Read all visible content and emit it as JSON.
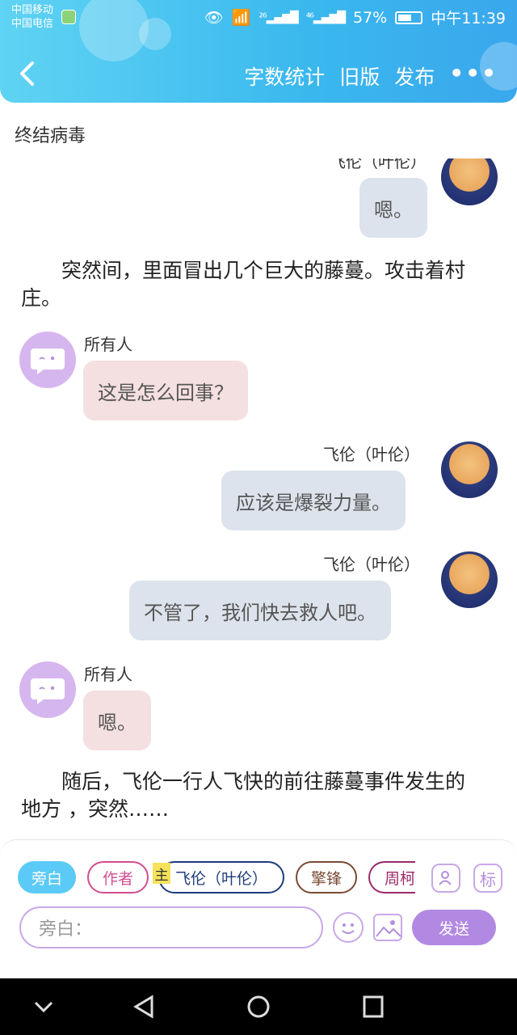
{
  "status_bar": {
    "carrier1": "中国移动",
    "carrier2": "中国电信",
    "sig1": "²⁶",
    "sig2": "⁴⁶",
    "battery": "57%",
    "time": "中午11:39"
  },
  "header": {
    "actions": [
      "字数统计",
      "旧版",
      "发布"
    ],
    "more": "•••"
  },
  "story_title": "终结病毒",
  "chat": {
    "msg0": {
      "name": "飞伦（叶伦）",
      "text": "嗯。"
    },
    "narr1": "突然间，里面冒出几个巨大的藤蔓。攻击着村庄。",
    "msg1": {
      "name": "所有人",
      "text": "这是怎么回事？"
    },
    "msg2": {
      "name": "飞伦（叶伦）",
      "text": "应该是爆裂力量。"
    },
    "msg3": {
      "name": "飞伦（叶伦）",
      "text": "不管了，我们快去救人吧。"
    },
    "msg4": {
      "name": "所有人",
      "text": "嗯。"
    },
    "narr2": "随后，飞伦一行人飞快的前往藤蔓事件发生的地方 ，突然……"
  },
  "input_panel": {
    "chips": [
      "旁白",
      "作者",
      "飞伦（叶伦）",
      "擎锋",
      "周柯"
    ],
    "main_tag": "主",
    "label_icon": "标",
    "placeholder": "旁白：",
    "send": "发送"
  },
  "colors": {
    "header": "#3ab8ee",
    "accent_purple": "#b289e2",
    "bubble_right": "#dde3ec",
    "bubble_left": "#f4dfe1"
  }
}
